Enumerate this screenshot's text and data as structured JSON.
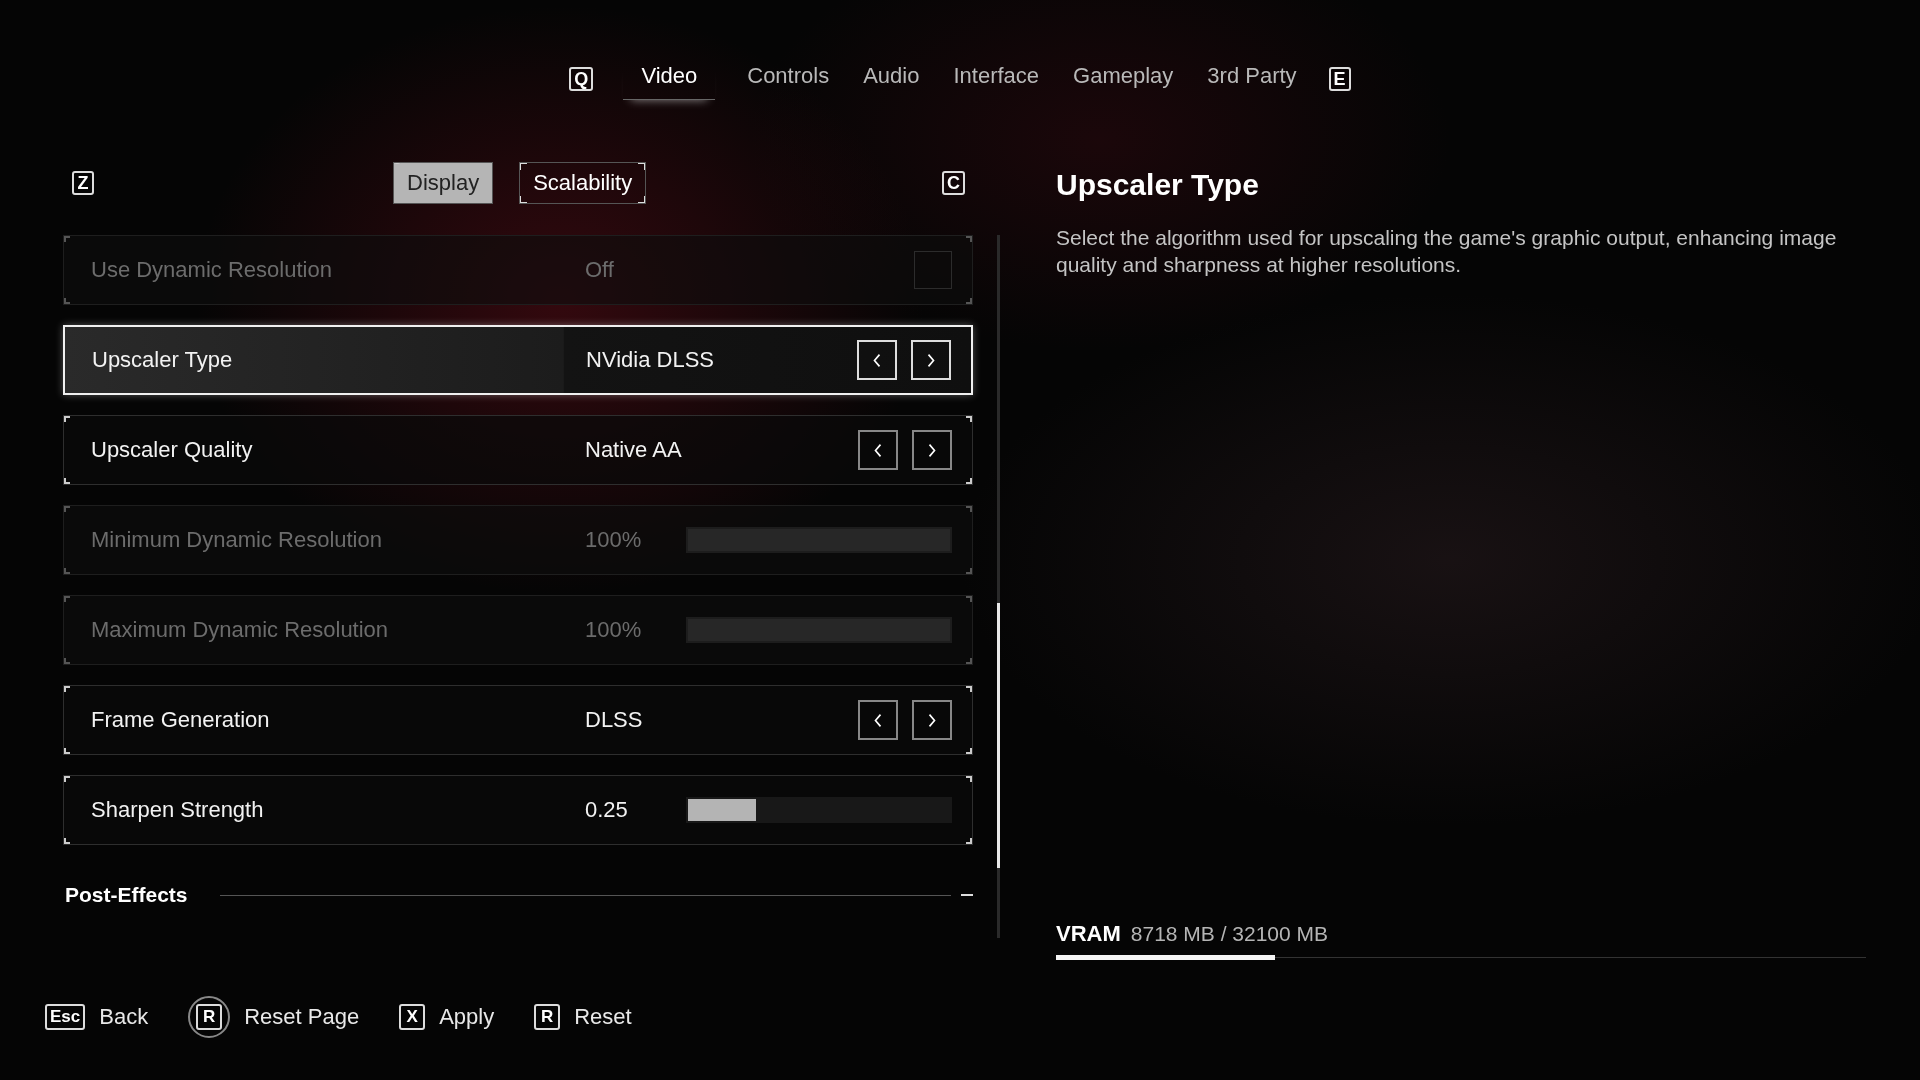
{
  "nav": {
    "prev_key": "Q",
    "next_key": "E",
    "tabs": [
      {
        "label": "Video",
        "selected": true
      },
      {
        "label": "Controls",
        "selected": false
      },
      {
        "label": "Audio",
        "selected": false
      },
      {
        "label": "Interface",
        "selected": false
      },
      {
        "label": "Gameplay",
        "selected": false
      },
      {
        "label": "3rd Party",
        "selected": false
      }
    ]
  },
  "subnav": {
    "prev_key": "Z",
    "next_key": "C",
    "tabs": [
      {
        "label": "Display",
        "selected": true
      },
      {
        "label": "Scalability",
        "selected": false
      }
    ]
  },
  "settings": [
    {
      "kind": "toggle",
      "label": "Use Dynamic Resolution",
      "value": "Off",
      "checked": false,
      "disabled": true,
      "selected": false
    },
    {
      "kind": "selector",
      "label": "Upscaler Type",
      "value": "NVidia DLSS",
      "disabled": false,
      "selected": true
    },
    {
      "kind": "selector",
      "label": "Upscaler Quality",
      "value": "Native AA",
      "disabled": false,
      "selected": false
    },
    {
      "kind": "slider",
      "label": "Minimum Dynamic Resolution",
      "value": "100%",
      "level": 1,
      "disabled": true,
      "selected": false
    },
    {
      "kind": "slider",
      "label": "Maximum Dynamic Resolution",
      "value": "100%",
      "level": 1,
      "disabled": true,
      "selected": false
    },
    {
      "kind": "selector",
      "label": "Frame Generation",
      "value": "DLSS",
      "disabled": false,
      "selected": false
    },
    {
      "kind": "slider",
      "label": "Sharpen Strength",
      "value": "0.25",
      "level": 0.26,
      "disabled": false,
      "selected": false
    }
  ],
  "section": {
    "title": "Post-Effects"
  },
  "details": {
    "title": "Upscaler Type",
    "description": "Select the algorithm used for upscaling the game's graphic output, enhancing image quality and sharpness at higher resolutions."
  },
  "vram": {
    "label": "VRAM",
    "reading": "8718 MB / 32100 MB",
    "level": 0.27
  },
  "hints": [
    {
      "kind": "key",
      "key": "Esc",
      "label": "Back"
    },
    {
      "kind": "hold",
      "key": "R",
      "label": "Reset Page"
    },
    {
      "kind": "key",
      "key": "X",
      "label": "Apply"
    },
    {
      "kind": "key",
      "key": "R",
      "label": "Reset"
    }
  ]
}
